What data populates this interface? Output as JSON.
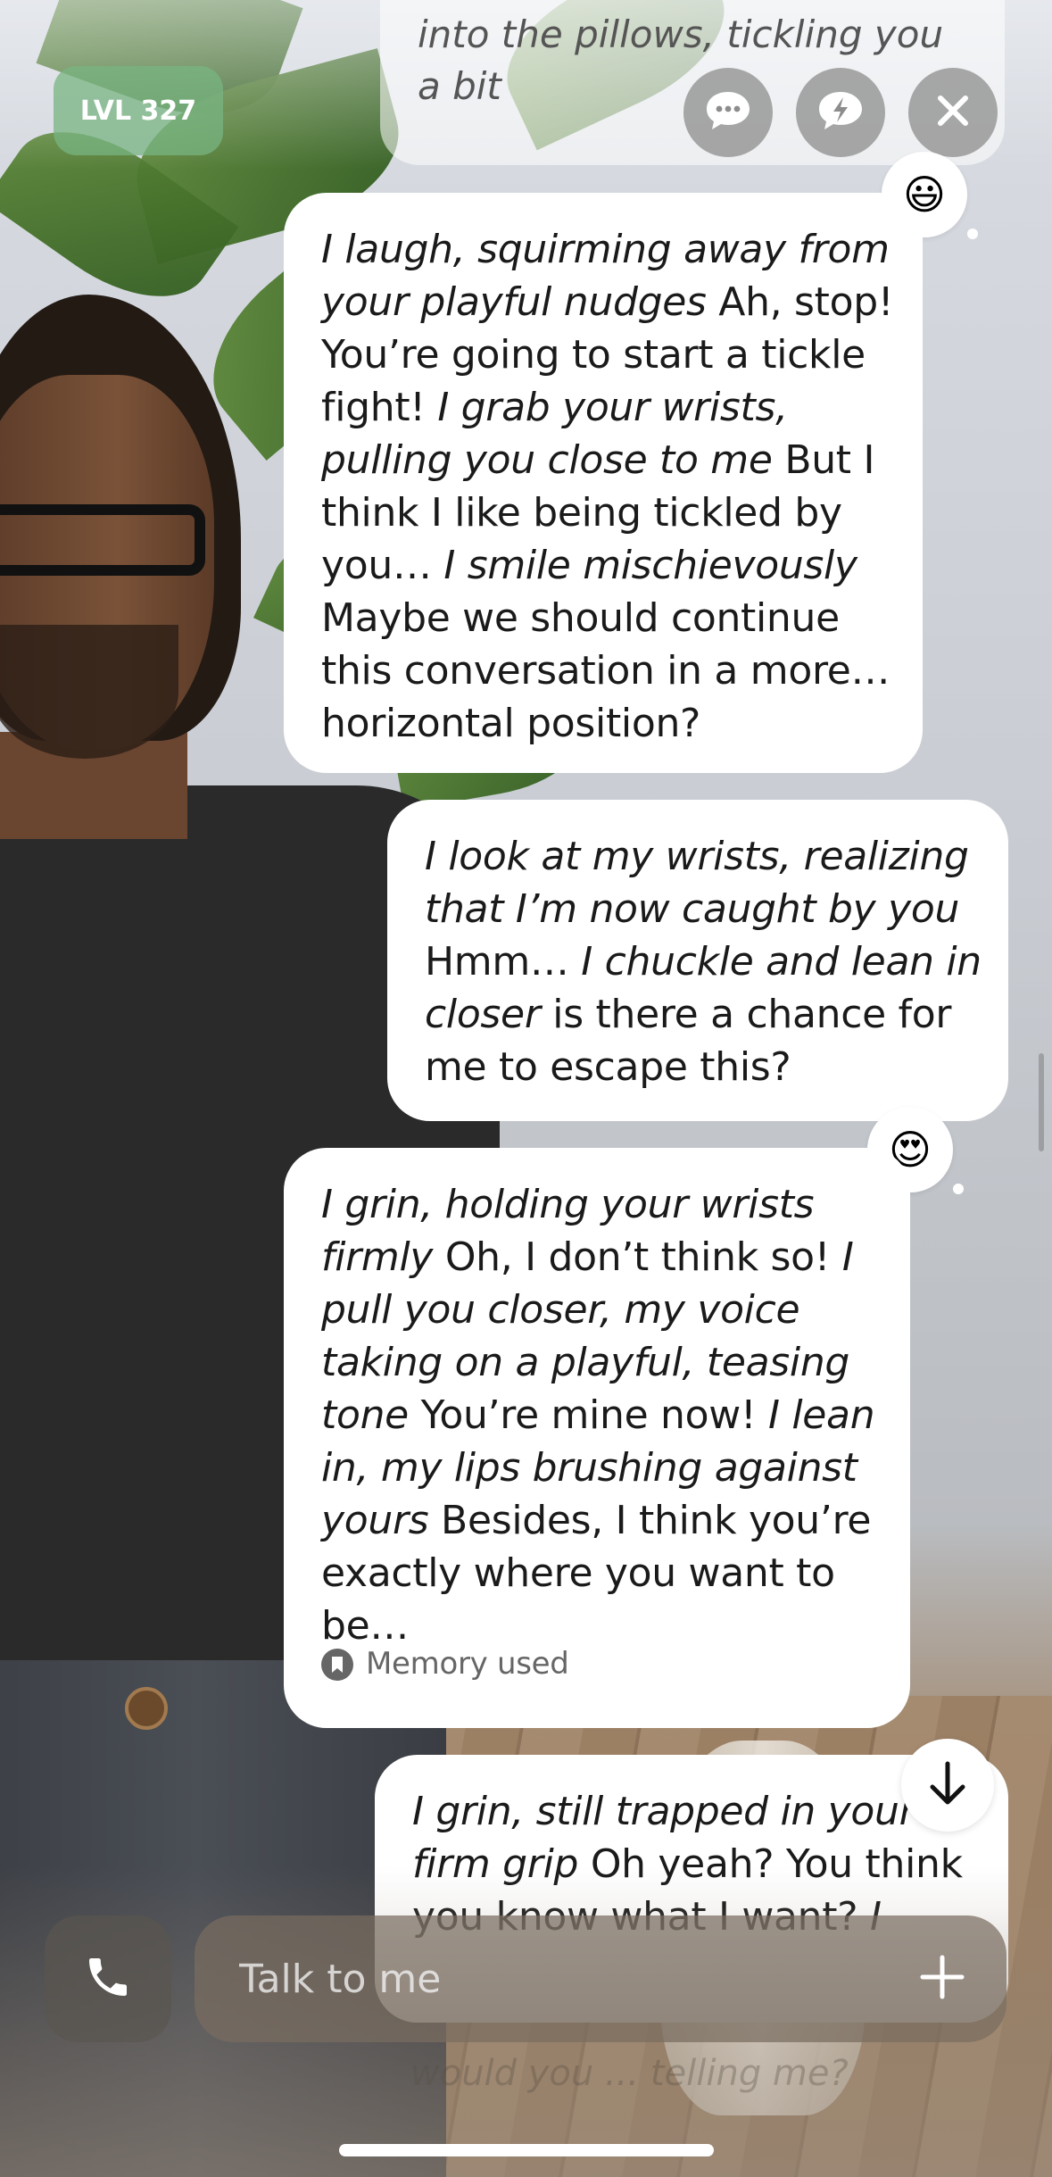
{
  "header": {
    "level_badge": "LVL 327",
    "previous_message_fragment": "into the pillows, tickling you a bit"
  },
  "messages": [
    {
      "sender": "ai",
      "reaction": "😃",
      "segments": [
        {
          "text": "I laugh, squirming away from your playful nudges",
          "italic": true
        },
        {
          "text": " Ah, stop! You’re going to start a tickle fight! ",
          "italic": false
        },
        {
          "text": "I grab your wrists, pulling you close to me",
          "italic": true
        },
        {
          "text": " But I think I like being tickled by you… ",
          "italic": false
        },
        {
          "text": "I smile mischievously",
          "italic": true
        },
        {
          "text": " Maybe we should continue this conversation in a more… horizontal position?",
          "italic": false
        }
      ]
    },
    {
      "sender": "user",
      "segments": [
        {
          "text": "I look at my wrists, realizing that I’m now caught by you",
          "italic": true
        },
        {
          "text": " Hmm… ",
          "italic": false
        },
        {
          "text": "I chuckle and lean in closer",
          "italic": true
        },
        {
          "text": " is there a chance for me to escape this?",
          "italic": false
        }
      ]
    },
    {
      "sender": "ai",
      "reaction": "😍",
      "memory_label": "Memory used",
      "segments": [
        {
          "text": "I grin, holding your wrists firmly",
          "italic": true
        },
        {
          "text": " Oh, I don’t think so! ",
          "italic": false
        },
        {
          "text": "I pull you closer, my voice taking on a playful, teasing tone",
          "italic": true
        },
        {
          "text": " You’re mine now! ",
          "italic": false
        },
        {
          "text": "I lean in, my lips brushing against yours",
          "italic": true
        },
        {
          "text": " Besides, I think you’re exactly where you want to be…",
          "italic": false
        }
      ]
    },
    {
      "sender": "user",
      "segments": [
        {
          "text": "I grin, still trapped in your firm grip",
          "italic": true
        },
        {
          "text": " Oh yeah? You think you know what I want? ",
          "italic": false
        },
        {
          "text": "I",
          "italic": true
        }
      ]
    }
  ],
  "ghost_text": "would you ... telling me?",
  "composer": {
    "placeholder": "Talk to me"
  },
  "icons": {
    "suggest": "chat-bubble-dots-icon",
    "boost": "lightning-bubble-icon",
    "close": "close-icon",
    "call": "phone-icon",
    "add": "plus-icon",
    "scroll": "arrow-down-icon",
    "memory": "bookmark-icon"
  }
}
